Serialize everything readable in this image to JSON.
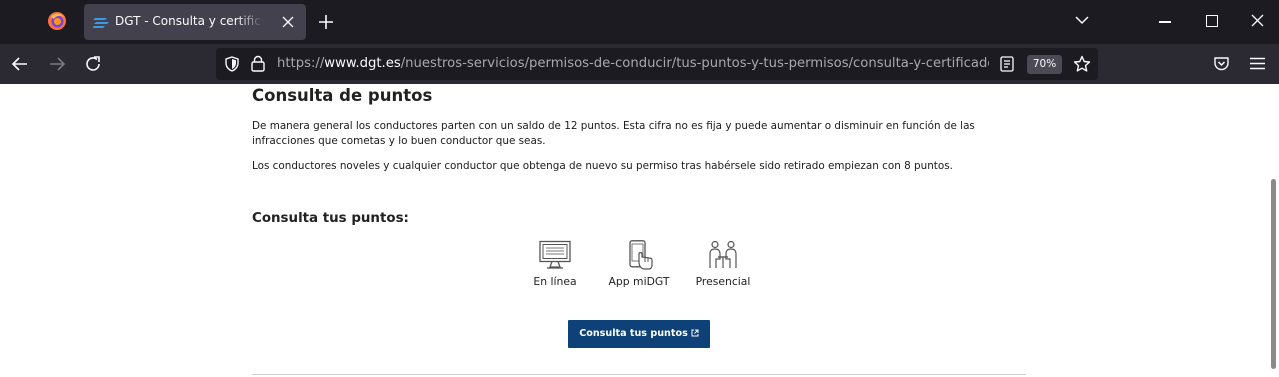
{
  "browser": {
    "tab": {
      "title": "DGT - Consulta y certificado de puntos"
    },
    "url": {
      "scheme": "https://",
      "host": "www.dgt.es",
      "path": "/nuestros-servicios/permisos-de-conducir/tus-puntos-y-tus-permisos/consulta-y-certificado-de-puntos/"
    },
    "zoom": "70%",
    "icons": [
      "firefox-logo",
      "dgt-favicon",
      "close-icon",
      "plus-icon",
      "chevron-down-icon",
      "minimize-icon",
      "maximize-icon",
      "back-arrow-icon",
      "forward-arrow-icon",
      "reload-icon",
      "shield-icon",
      "lock-icon",
      "reader-view-icon",
      "star-icon",
      "pocket-icon",
      "hamburger-menu-icon"
    ]
  },
  "page": {
    "section_title": "Consulta de puntos",
    "paragraphs": [
      "De manera general los conductores parten con un saldo de 12 puntos. Esta cifra no es fija y puede aumentar o disminuir en función de las infracciones que cometas y lo buen conductor que seas.",
      "Los conductores noveles y cualquier conductor que obtenga de nuevo su permiso tras habérsele sido retirado empiezan con 8 puntos."
    ],
    "consulta_title": "Consulta tus puntos:",
    "options": [
      {
        "label": "En línea",
        "icon": "computer-monitor-icon"
      },
      {
        "label": "App miDGT",
        "icon": "smartphone-touch-icon"
      },
      {
        "label": "Presencial",
        "icon": "in-person-meeting-icon"
      }
    ],
    "cta": {
      "label": "Consulta tus puntos",
      "icon": "external-link-icon"
    }
  }
}
